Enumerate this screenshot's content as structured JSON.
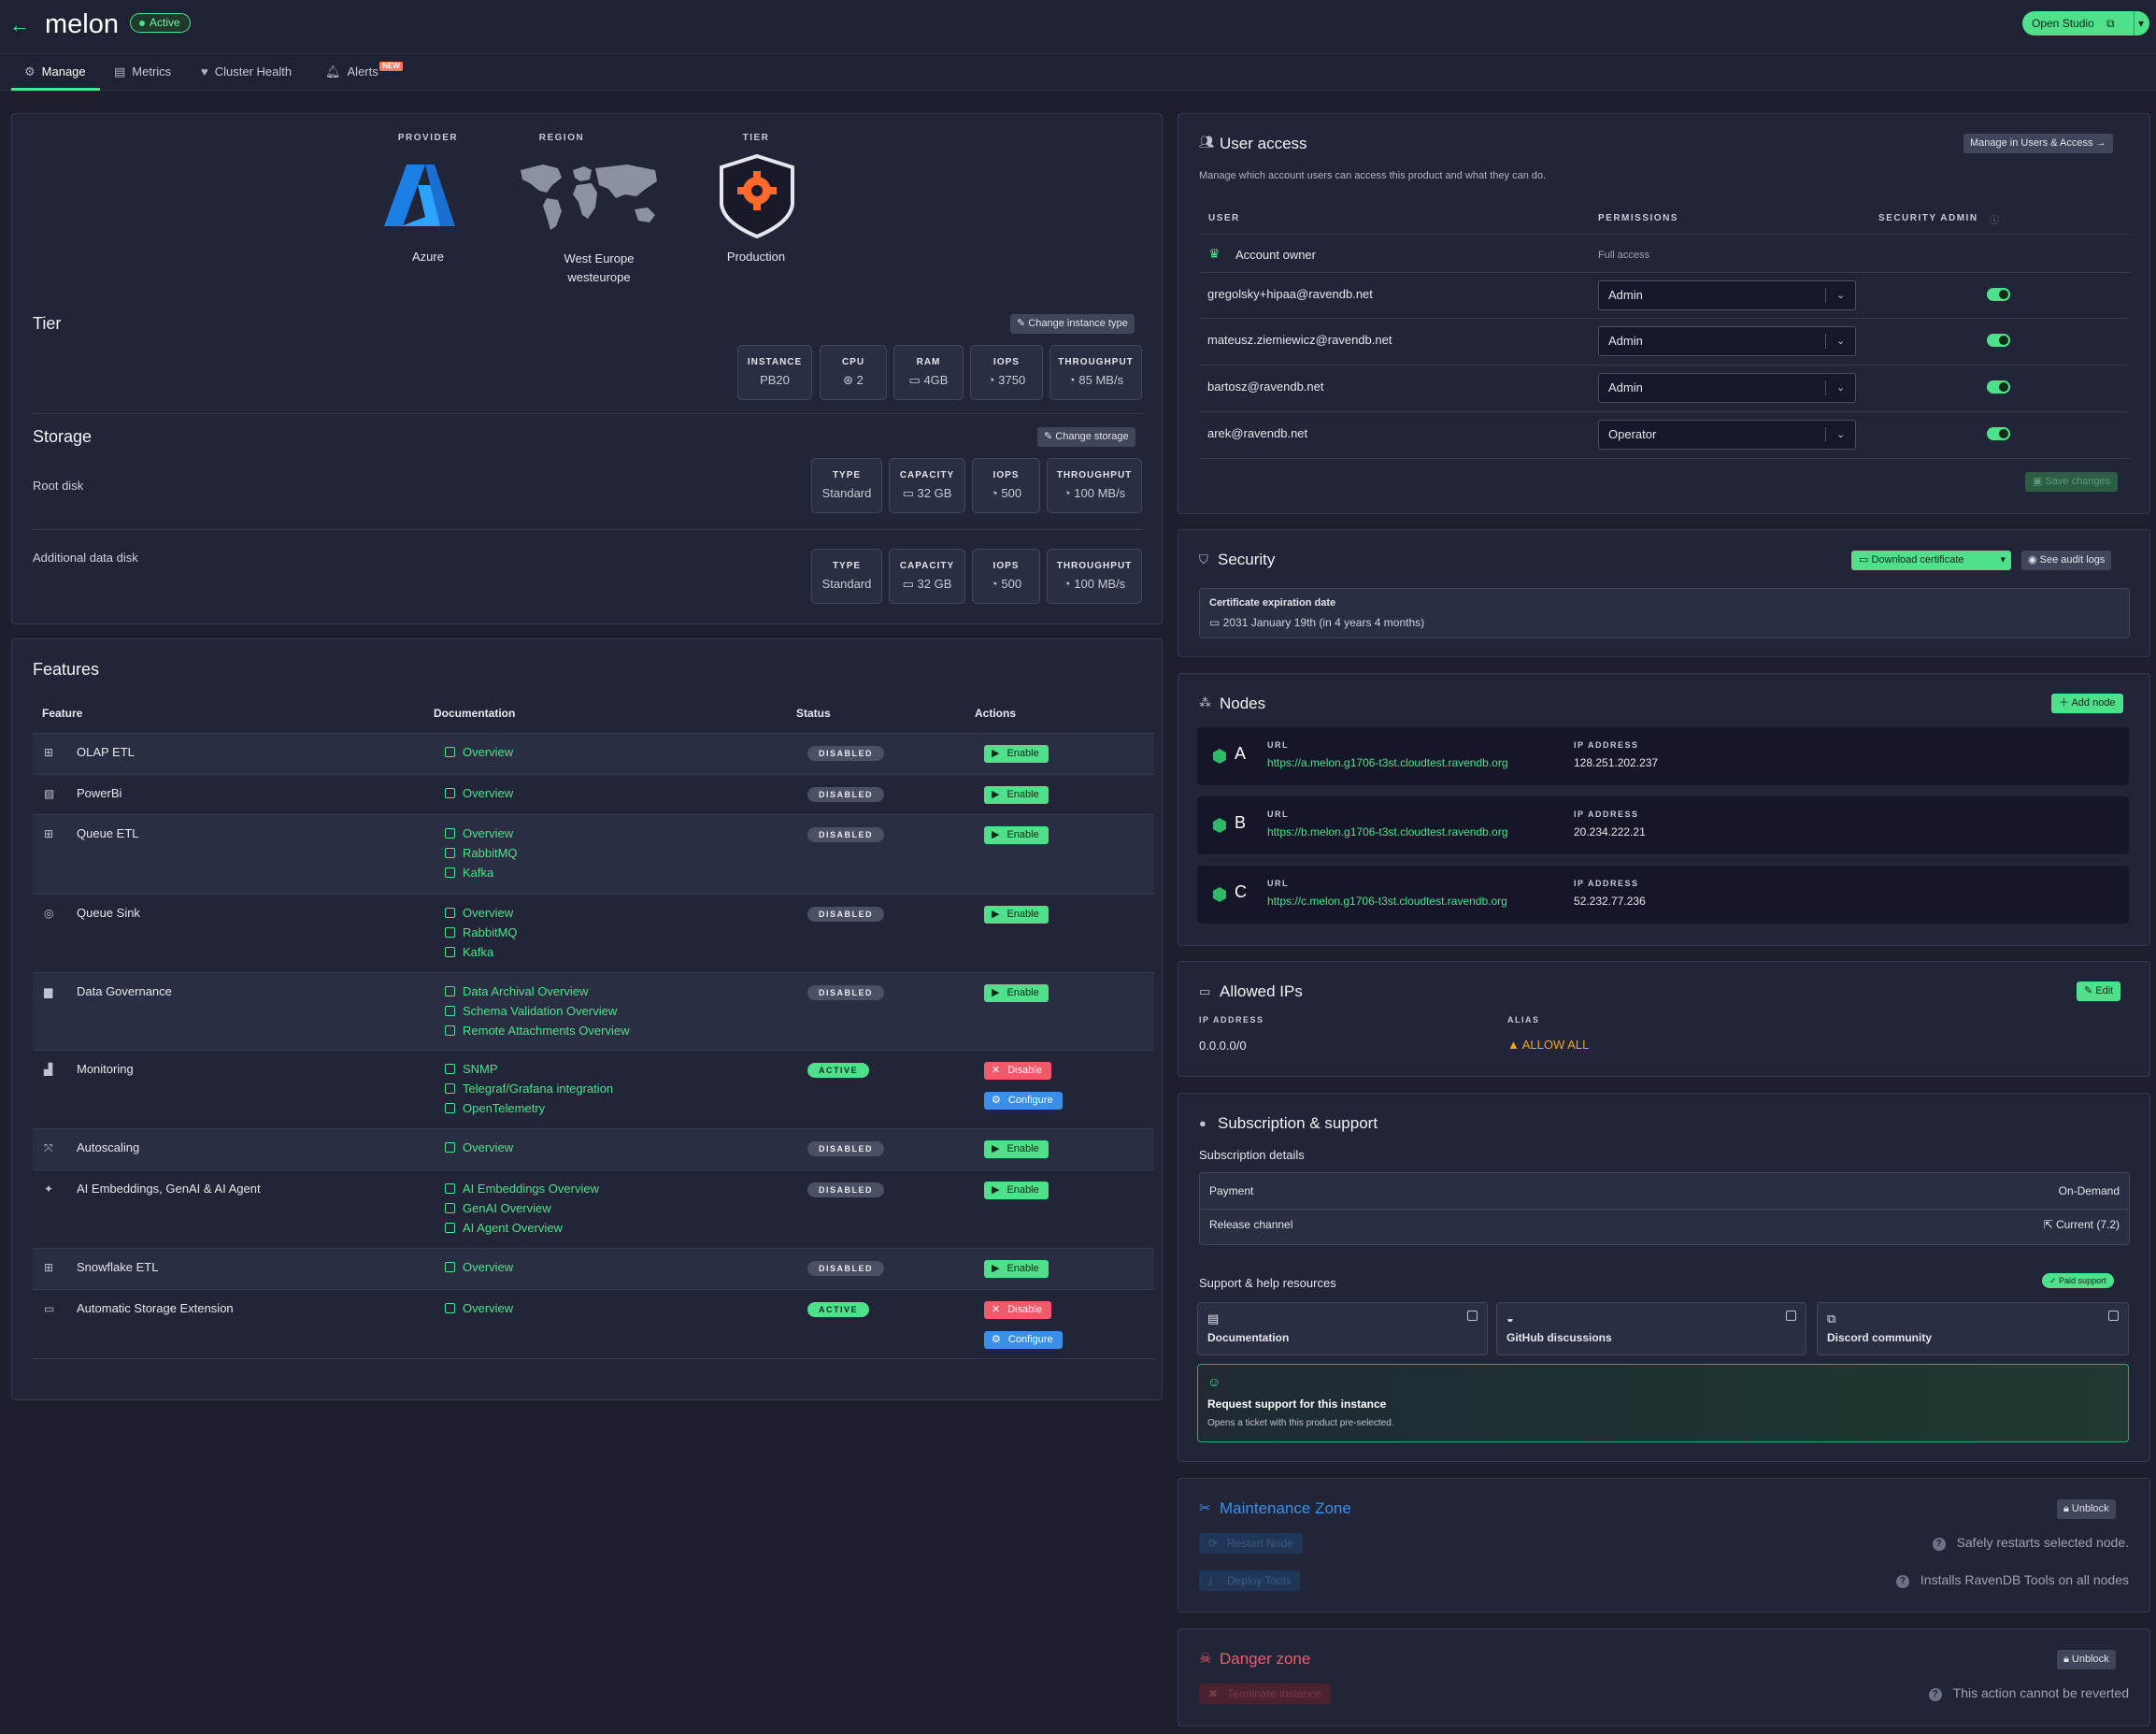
{
  "header": {
    "back_icon": "arrow-left-icon",
    "title": "melon",
    "status": "Active",
    "open_studio": "Open Studio"
  },
  "tabs": [
    {
      "label": "Manage",
      "icon": "gear-icon"
    },
    {
      "label": "Metrics",
      "icon": "chart-icon"
    },
    {
      "label": "Cluster Health",
      "icon": "heart-icon"
    },
    {
      "label": "Alerts",
      "icon": "bell-icon",
      "badge": "NEW"
    }
  ],
  "overview": {
    "provider": {
      "label": "PROVIDER",
      "value": "Azure"
    },
    "region": {
      "label": "REGION",
      "value": "West Europe",
      "sub": "westeurope"
    },
    "tier": {
      "label": "TIER",
      "value": "Production"
    }
  },
  "tier": {
    "title": "Tier",
    "change_btn": "Change instance type",
    "specs": [
      {
        "label": "INSTANCE",
        "value": "PB20"
      },
      {
        "label": "CPU",
        "value": "2"
      },
      {
        "label": "RAM",
        "value": "4GB"
      },
      {
        "label": "IOPS",
        "value": "3750"
      },
      {
        "label": "THROUGHPUT",
        "value": "85 MB/s"
      }
    ]
  },
  "storage": {
    "title": "Storage",
    "change_btn": "Change storage",
    "root": {
      "label": "Root disk",
      "type_label": "TYPE",
      "type": "Standard",
      "capacity_label": "CAPACITY",
      "capacity": "32 GB",
      "iops_label": "IOPS",
      "iops": "500",
      "throughput_label": "THROUGHPUT",
      "throughput": "100 MB/s"
    },
    "additional": {
      "label": "Additional data disk",
      "type_label": "TYPE",
      "type": "Standard",
      "capacity_label": "CAPACITY",
      "capacity": "32 GB",
      "iops_label": "IOPS",
      "iops": "500",
      "throughput_label": "THROUGHPUT",
      "throughput": "100 MB/s"
    }
  },
  "features": {
    "title": "Features",
    "columns": [
      "Feature",
      "Documentation",
      "Status",
      "Actions"
    ],
    "rows": [
      {
        "name": "OLAP ETL",
        "docs": [
          "Overview"
        ],
        "status": "DISABLED",
        "actions": [
          "Enable"
        ]
      },
      {
        "name": "PowerBi",
        "docs": [
          "Overview"
        ],
        "status": "DISABLED",
        "actions": [
          "Enable"
        ]
      },
      {
        "name": "Queue ETL",
        "docs": [
          "Overview",
          "RabbitMQ",
          "Kafka"
        ],
        "status": "DISABLED",
        "actions": [
          "Enable"
        ]
      },
      {
        "name": "Queue Sink",
        "docs": [
          "Overview",
          "RabbitMQ",
          "Kafka"
        ],
        "status": "DISABLED",
        "actions": [
          "Enable"
        ]
      },
      {
        "name": "Data Governance",
        "docs": [
          "Data Archival Overview",
          "Schema Validation Overview",
          "Remote Attachments Overview"
        ],
        "status": "DISABLED",
        "actions": [
          "Enable"
        ]
      },
      {
        "name": "Monitoring",
        "docs": [
          "SNMP",
          "Telegraf/Grafana integration",
          "OpenTelemetry"
        ],
        "status": "ACTIVE",
        "actions": [
          "Disable",
          "Configure"
        ]
      },
      {
        "name": "Autoscaling",
        "docs": [
          "Overview"
        ],
        "status": "DISABLED",
        "actions": [
          "Enable"
        ]
      },
      {
        "name": "AI Embeddings, GenAI & AI Agent",
        "docs": [
          "AI Embeddings Overview",
          "GenAI Overview",
          "AI Agent Overview"
        ],
        "status": "DISABLED",
        "actions": [
          "Enable"
        ]
      },
      {
        "name": "Snowflake ETL",
        "docs": [
          "Overview"
        ],
        "status": "DISABLED",
        "actions": [
          "Enable"
        ]
      },
      {
        "name": "Automatic Storage Extension",
        "docs": [
          "Overview"
        ],
        "status": "ACTIVE",
        "actions": [
          "Disable",
          "Configure"
        ]
      }
    ]
  },
  "user_access": {
    "title": "User access",
    "manage_btn": "Manage in Users & Access",
    "desc": "Manage which account users can access this product and what they can do.",
    "col_user": "USER",
    "col_perm": "PERMISSIONS",
    "col_admin": "SECURITY ADMIN",
    "owner": {
      "label": "Account owner",
      "perm": "Full access"
    },
    "users": [
      {
        "email": "gregolsky+hipaa@ravendb.net",
        "perm": "Admin"
      },
      {
        "email": "mateusz.ziemiewicz@ravendb.net",
        "perm": "Admin"
      },
      {
        "email": "bartosz@ravendb.net",
        "perm": "Admin"
      },
      {
        "email": "arek@ravendb.net",
        "perm": "Operator"
      }
    ],
    "save_btn": "Save changes"
  },
  "security": {
    "title": "Security",
    "download_btn": "Download certificate",
    "audit_btn": "See audit logs",
    "cert_label": "Certificate expiration date",
    "cert_value": "2031 January 19th (in 4 years 4 months)"
  },
  "nodes": {
    "title": "Nodes",
    "add_btn": "Add node",
    "url_label": "URL",
    "ip_label": "IP ADDRESS",
    "items": [
      {
        "tag": "A",
        "url": "https://a.melon.g1706-t3st.cloudtest.ravendb.org",
        "ip": "128.251.202.237"
      },
      {
        "tag": "B",
        "url": "https://b.melon.g1706-t3st.cloudtest.ravendb.org",
        "ip": "20.234.222.21"
      },
      {
        "tag": "C",
        "url": "https://c.melon.g1706-t3st.cloudtest.ravendb.org",
        "ip": "52.232.77.236"
      }
    ]
  },
  "allowed_ips": {
    "title": "Allowed IPs",
    "edit_btn": "Edit",
    "ip_label": "IP ADDRESS",
    "alias_label": "ALIAS",
    "ip": "0.0.0.0/0",
    "alias": "ALLOW ALL"
  },
  "subscription": {
    "title": "Subscription & support",
    "details_label": "Subscription details",
    "payment_label": "Payment",
    "payment": "On-Demand",
    "channel_label": "Release channel",
    "channel": "Current (7.2)",
    "support_label": "Support & help resources",
    "paid_badge": "Paid support",
    "resources": [
      "Documentation",
      "GitHub discussions",
      "Discord community"
    ],
    "request_title": "Request support for this instance",
    "request_desc": "Opens a ticket with this product pre-selected."
  },
  "maintenance": {
    "title": "Maintenance Zone",
    "unblock": "Unblock",
    "restart_btn": "Restart Node",
    "restart_hint": "Safely restarts selected node.",
    "deploy_btn": "Deploy Tools",
    "deploy_hint": "Installs RavenDB Tools on all nodes"
  },
  "danger": {
    "title": "Danger zone",
    "unblock": "Unblock",
    "terminate_btn": "Terminate instance",
    "hint": "This action cannot be reverted"
  },
  "colors": {
    "accent": "#4ee08a",
    "danger": "#ef5b6a",
    "info": "#3a8fe9",
    "bg": "#1d1f2f"
  }
}
